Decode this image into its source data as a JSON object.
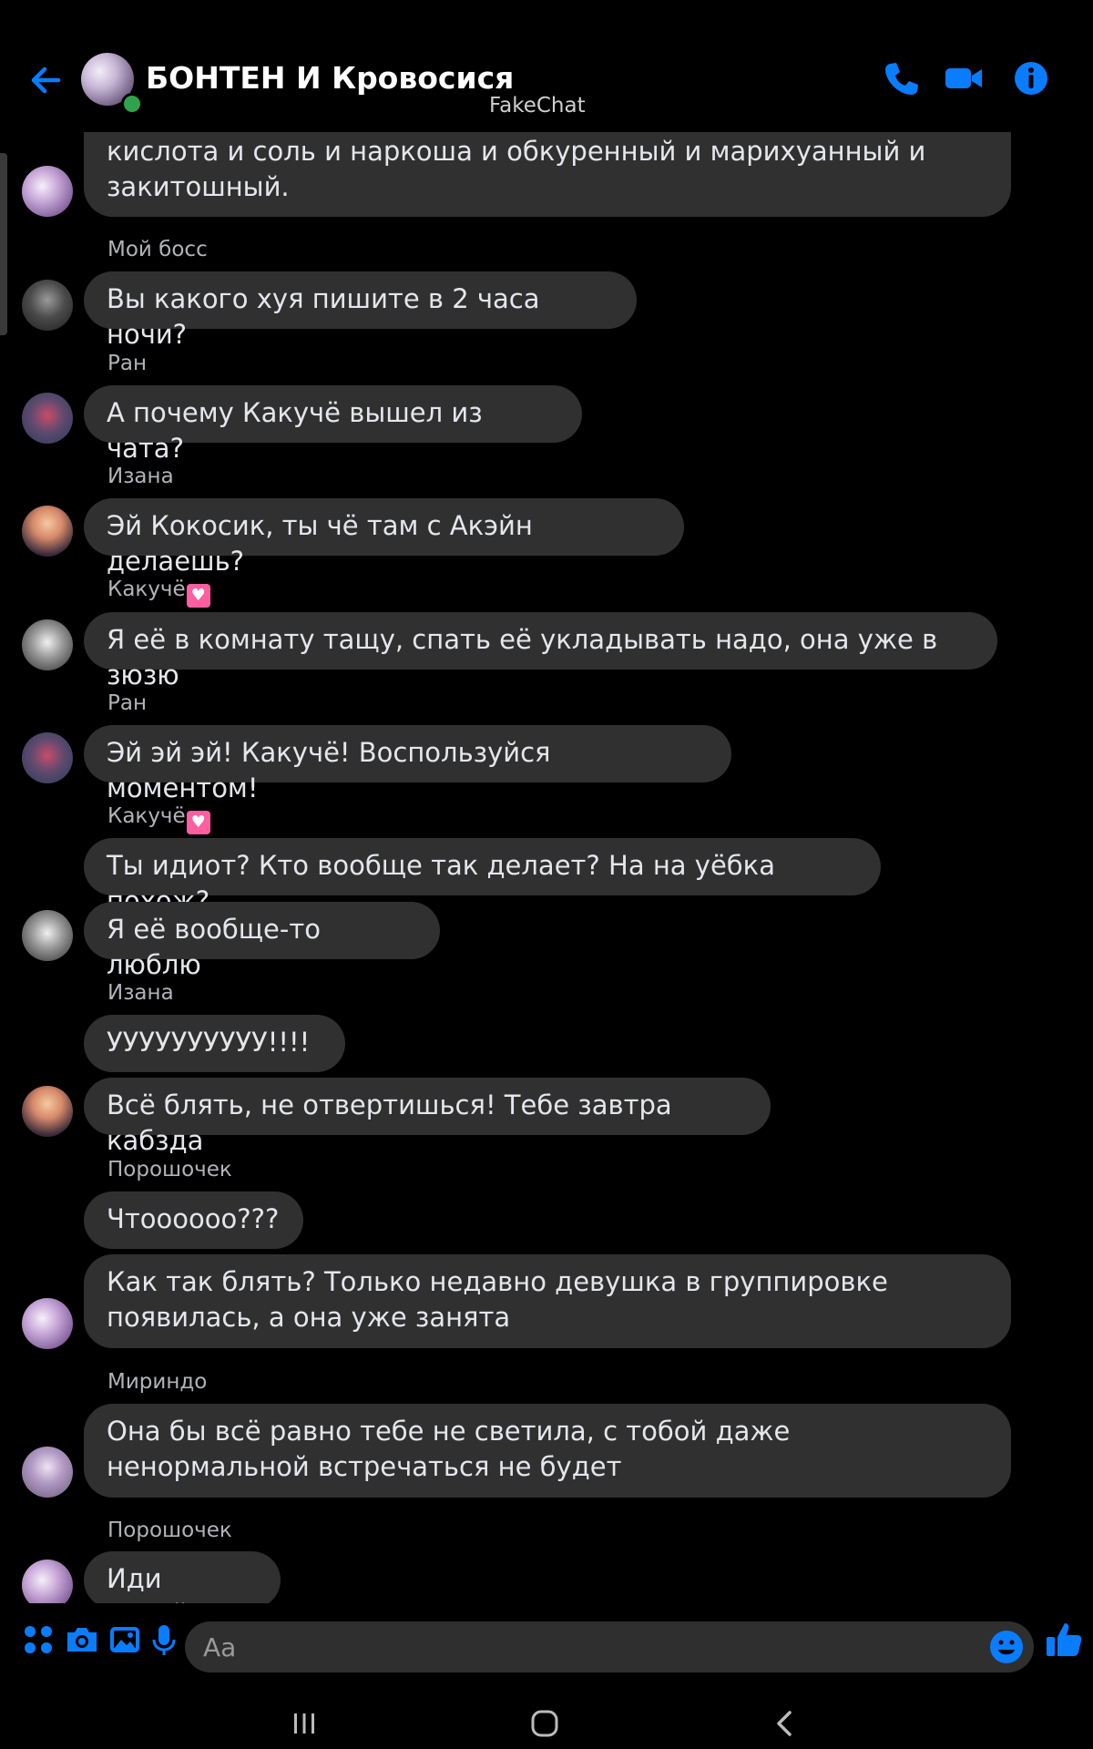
{
  "header": {
    "back_icon": "arrow-left-icon",
    "title": "БОНТЕН И Кровосися",
    "watermark": "FakeChat",
    "actions": [
      "phone-icon",
      "video-icon",
      "info-icon"
    ],
    "accent": "#0a7cff"
  },
  "messages": {
    "m0": {
      "text": "Меня уже как не подписывали. Я и порошок и таблетка и кислота и соль и наркоша и обкуренный и марихуанный и закитошный."
    },
    "m1": {
      "sender": "Мой босс",
      "text": "Вы какого хуя пишите в 2 часа ночи?"
    },
    "m2": {
      "sender": "Ран",
      "text": "А почему Какучё вышел из чата?"
    },
    "m3": {
      "sender": "Изана",
      "text": "Эй Кокосик, ты чё там с Акэйн делаешь?"
    },
    "m4": {
      "sender": "Какучё",
      "text": "Я её в комнату тащу, спать её укладывать надо, она уже в зюзю"
    },
    "m5": {
      "sender": "Ран",
      "text": "Эй эй эй! Какучё! Воспользуйся моментом!"
    },
    "m6": {
      "sender": "Какучё",
      "text": "Ты идиот? Кто вообще так делает? На на уёбка похож?"
    },
    "m7": {
      "text": "Я её вообще-то люблю"
    },
    "m8": {
      "sender": "Изана",
      "text": "УУУУУУУУУУ!!!!"
    },
    "m9": {
      "text": "Всё блять, не отвертишься! Тебе завтра кабзда"
    },
    "m10": {
      "sender": "Порошочек",
      "text": "Чтоооооо???"
    },
    "m11": {
      "text": "Как так блять? Только недавно девушка в группировке появилась, а она уже занята"
    },
    "m12": {
      "sender": "Мириндо",
      "text": "Она бы всё равно тебе не светила, с тобой даже ненормальной встречаться не будет"
    },
    "m13": {
      "sender": "Порошочек",
      "text": "Иди нахуй!"
    }
  },
  "composer": {
    "icons": [
      "apps-icon",
      "camera-icon",
      "gallery-icon",
      "microphone-icon"
    ],
    "placeholder": "Aa",
    "emoji_icon": "smiley-icon",
    "like_icon": "thumbs-up-icon"
  },
  "navbar": [
    "recent-apps-icon",
    "home-icon",
    "back-nav-icon"
  ]
}
